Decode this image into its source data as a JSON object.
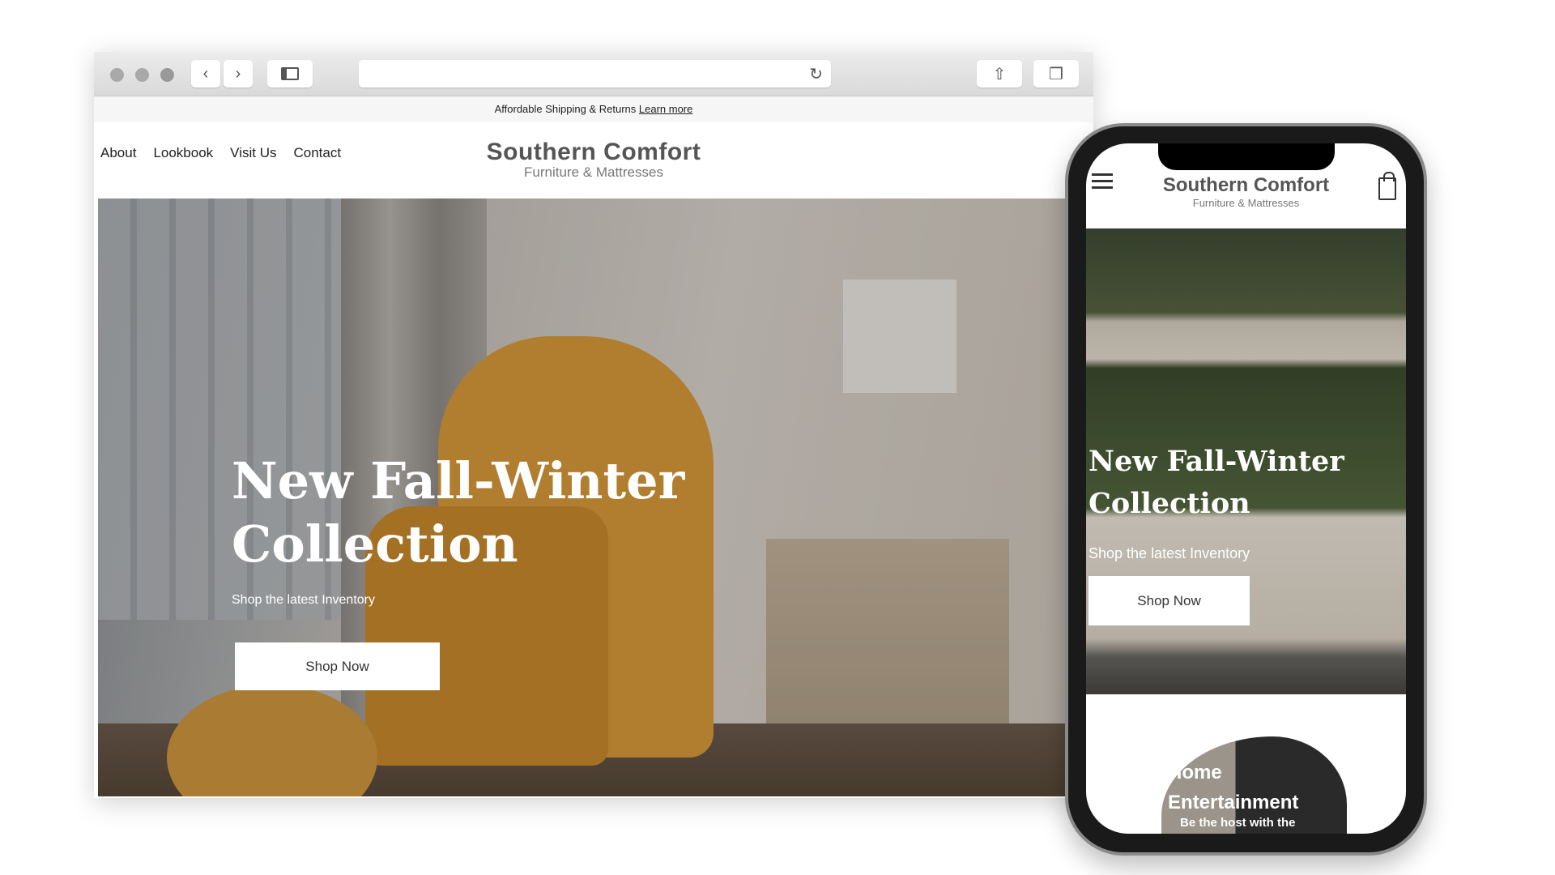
{
  "browser": {
    "toolbar": {
      "traffic_lights": [
        "close",
        "minimize",
        "zoom"
      ],
      "back_icon": "chevron-left",
      "forward_icon": "chevron-right",
      "sidebar_icon": "sidebar",
      "reload_icon": "reload",
      "share_icon": "share",
      "tabs_icon": "tabs"
    }
  },
  "announcement": {
    "text": "Affordable Shipping & Returns",
    "link": "Learn more"
  },
  "nav": {
    "items": [
      "About",
      "Lookbook",
      "Visit Us",
      "Contact"
    ]
  },
  "brand": {
    "title": "Southern Comfort",
    "subtitle": "Furniture & Mattresses"
  },
  "hero": {
    "title": "New Fall-Winter\nCollection",
    "subtitle": "Shop the latest Inventory",
    "button": "Shop Now"
  },
  "mobile": {
    "brand": {
      "title": "Southern Comfort",
      "subtitle": "Furniture & Mattresses"
    },
    "hero": {
      "title": "New Fall-Winter\nCollection",
      "subtitle": "Shop the latest Inventory",
      "button": "Shop Now"
    },
    "category": {
      "title": "Home\nEntertainment",
      "subtitle": "Be the host with the"
    }
  }
}
